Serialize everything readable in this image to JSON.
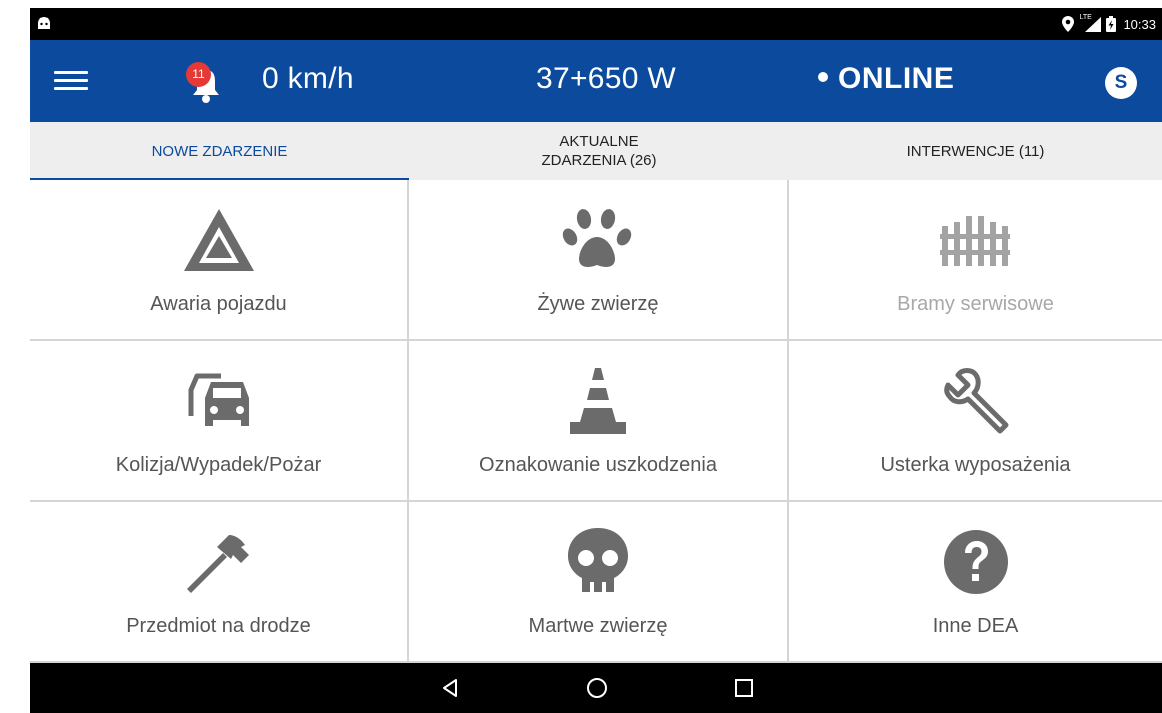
{
  "status_bar": {
    "time": "10:33",
    "network_label": "LTE",
    "icons": [
      "android-icon",
      "location-icon",
      "lte-signal-icon",
      "battery-charging-icon"
    ]
  },
  "app_bar": {
    "notifications_count": "11",
    "speed": "0 km/h",
    "road_position": "37+650 W",
    "connection_status": "ONLINE",
    "user_initial": "S",
    "brand_color": "#0b4a9c",
    "badge_color": "#e53935"
  },
  "tabs": [
    {
      "label": "NOWE ZDARZENIE",
      "active": true
    },
    {
      "label": "AKTUALNE\nZDARZENIA (26)",
      "active": false
    },
    {
      "label": "INTERWENCJE (11)",
      "active": false
    }
  ],
  "events": [
    {
      "label": "Awaria pojazdu",
      "icon": "hazard-triangle-icon",
      "enabled": true
    },
    {
      "label": "Żywe zwierzę",
      "icon": "paw-icon",
      "enabled": true
    },
    {
      "label": "Bramy serwisowe",
      "icon": "fence-gate-icon",
      "enabled": false
    },
    {
      "label": "Kolizja/Wypadek/Pożar",
      "icon": "car-collision-icon",
      "enabled": true
    },
    {
      "label": "Oznakowanie uszkodzenia",
      "icon": "traffic-cone-icon",
      "enabled": true
    },
    {
      "label": "Usterka wyposażenia",
      "icon": "wrench-icon",
      "enabled": true
    },
    {
      "label": "Przedmiot na drodze",
      "icon": "hammer-icon",
      "enabled": true
    },
    {
      "label": "Martwe zwierzę",
      "icon": "skull-icon",
      "enabled": true
    },
    {
      "label": "Inne DEA",
      "icon": "question-circle-icon",
      "enabled": true
    }
  ],
  "nav_bar": {
    "buttons": [
      "back-icon",
      "home-icon",
      "recents-icon"
    ]
  }
}
